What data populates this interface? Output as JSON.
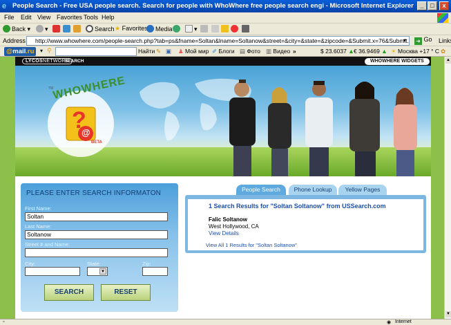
{
  "window": {
    "title": "People Search - Free USA people search. Search for people with WhoWhere free people search engi - Microsoft Internet Explorer",
    "buttons": [
      "_",
      "□",
      "x"
    ]
  },
  "menu": [
    "File",
    "Edit",
    "View",
    "Favorites",
    "Tools",
    "Help"
  ],
  "toolbar": {
    "back": "Back",
    "search": "Search",
    "favorites": "Favorites",
    "media": "Media"
  },
  "address": {
    "label": "Address",
    "url": "http://www.whowhere.com/people-search.php?tab=ps&fname=Soltan&lname=Soltanow&street=&city=&state=&zipcode=&Submit.x=76&Submit.y=21",
    "go": "Go",
    "links": "Links"
  },
  "mailbar": {
    "logo_prefix": "@",
    "logo_main": "mail",
    "logo_suffix": ".ru",
    "find": "Найти",
    "my_world": "Мой мир",
    "blogs": "Блоги",
    "photo": "Фото",
    "video": "Видео",
    "more": "»",
    "usd": "$ 23.6037",
    "eur": "€ 36.9469",
    "weather": "Москва +17 ° C"
  },
  "site": {
    "lycos_brand": "LYCOS",
    "lycos_network": "NETWORK",
    "strip_search": "SEARCH",
    "widgets": "WHOWHERE WIDGETS",
    "logo_tm": "TM",
    "logo_text": "WHOWHERE",
    "logo_mark": "?",
    "logo_at": "@",
    "logo_beta": "BETA"
  },
  "search_form": {
    "heading": "PLEASE ENTER SEARCH INFORMATON",
    "first_name_label": "First Name:",
    "first_name_value": "Soltan",
    "last_name_label": "Last Name:",
    "last_name_value": "Soltanow",
    "street_label": "Street # and Name:",
    "street_value": "",
    "city_label": "City:",
    "state_label": "State:",
    "zip_label": "Zip:",
    "search_button": "SEARCH",
    "reset_button": "RESET"
  },
  "tabs": [
    {
      "label": "People Search",
      "active": true
    },
    {
      "label": "Phone Lookup",
      "active": false
    },
    {
      "label": "Yellow Pages",
      "active": false
    }
  ],
  "results": {
    "header": "1 Search Results for \"Soltan Soltanow\" from USSearch.com",
    "name": "Falic Soltanow",
    "location": "West Hollywood, CA",
    "details_link": "View Details",
    "view_all": "View All 1 Results for \"Soltan Soltanow\""
  },
  "status": {
    "zone": "Internet"
  },
  "colors": {
    "title_bar": "#0a5fd8",
    "page_bg": "#8cc04b",
    "panel_blue": "#4c9fdb",
    "link_blue": "#1f4fa8"
  }
}
